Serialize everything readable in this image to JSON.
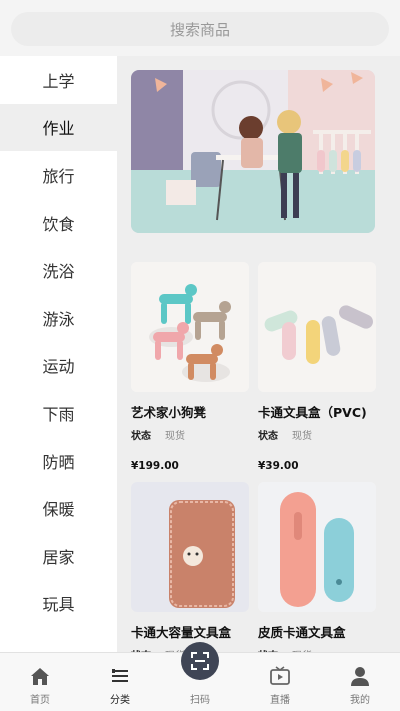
{
  "search": {
    "placeholder": "搜索商品"
  },
  "categories": [
    "上学",
    "作业",
    "旅行",
    "饮食",
    "洗浴",
    "游泳",
    "运动",
    "下雨",
    "防晒",
    "保暖",
    "居家",
    "玩具"
  ],
  "active_category": "作业",
  "products": [
    {
      "title": "艺术家小狗凳",
      "status_label": "状态",
      "status_value": "现货",
      "price": "¥199.00"
    },
    {
      "title": "卡通文具盒（PVC)",
      "status_label": "状态",
      "status_value": "现货",
      "price": "¥39.00"
    },
    {
      "title": "卡通大容量文具盒",
      "status_label": "状态",
      "status_value": "现货",
      "price": ""
    },
    {
      "title": "皮质卡通文具盒",
      "status_label": "状态",
      "status_value": "现货",
      "price": ""
    }
  ],
  "tabbar": {
    "home": "首页",
    "category": "分类",
    "scan": "扫码",
    "live": "直播",
    "mine": "我的"
  },
  "colors": {
    "accent_dark": "#3f4555",
    "background": "#eeeeee"
  }
}
